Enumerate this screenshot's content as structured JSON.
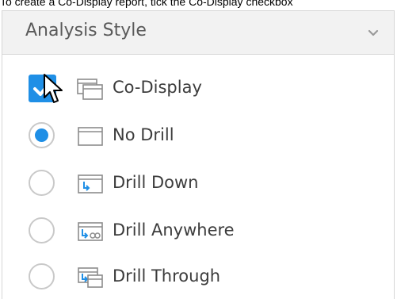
{
  "caption": "To create a Co-Display report, tick the Co-Display checkbox",
  "panel": {
    "title": "Analysis Style"
  },
  "options": [
    {
      "label": "Co-Display",
      "control": "checkbox",
      "checked": true,
      "icon": "co-display-icon"
    },
    {
      "label": "No Drill",
      "control": "radio",
      "checked": true,
      "icon": "no-drill-icon"
    },
    {
      "label": "Drill Down",
      "control": "radio",
      "checked": false,
      "icon": "drill-down-icon"
    },
    {
      "label": "Drill Anywhere",
      "control": "radio",
      "checked": false,
      "icon": "drill-anywhere-icon"
    },
    {
      "label": "Drill Through",
      "control": "radio",
      "checked": false,
      "icon": "drill-through-icon"
    }
  ],
  "colors": {
    "accent": "#1f8fe6",
    "header_bg": "#f2f2f2",
    "border": "#d6d6d6"
  }
}
